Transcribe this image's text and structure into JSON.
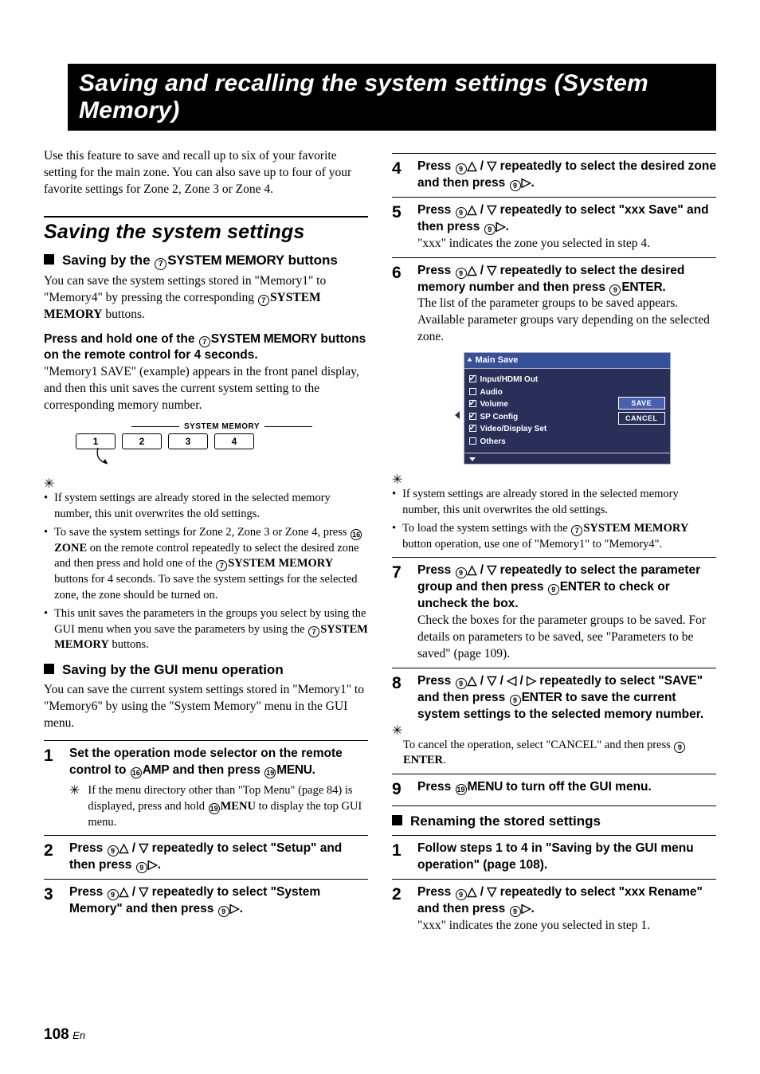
{
  "page": {
    "title": "Saving and recalling the system settings (System Memory)",
    "intro": "Use this feature to save and recall up to six of your favorite setting for the main zone. You can also save up to four of your favorite settings for Zone 2, Zone 3 or Zone 4.",
    "number": "108",
    "lang": "En"
  },
  "left": {
    "section_heading": "Saving the system settings",
    "sub1_prefix": "Saving by the ",
    "sub1_heavy": "SYSTEM MEMORY",
    "sub1_suffix": " buttons",
    "p1a": "You can save the system settings stored in \"Memory1\" to \"Memory4\" by pressing the corresponding ",
    "p1b": "SYSTEM MEMORY",
    "p1c": " buttons.",
    "press_lead_a": "Press and hold one of the ",
    "press_lead_b": "SYSTEM MEMORY",
    "press_lead_c": " buttons on the remote control for 4 seconds.",
    "press_body": "\"Memory1 SAVE\" (example) appears in the front panel display, and then this unit saves the current system setting to the corresponding memory number.",
    "sysmem_label": "SYSTEM MEMORY",
    "keys": [
      "1",
      "2",
      "3",
      "4"
    ],
    "tips1": {
      "b1": "If system settings are already stored in the selected memory number, this unit overwrites the old settings.",
      "b2a": "To save the system settings for Zone 2, Zone 3 or Zone 4, press ",
      "b2b": "ZONE",
      "b2c": " on the remote control repeatedly to select the desired zone and then press and hold one of the ",
      "b2d": "SYSTEM MEMORY",
      "b2e": " buttons for 4 seconds. To save the system settings for the selected zone, the zone should be turned on.",
      "b3a": "This unit saves the parameters in the groups you select by using the GUI menu when you save the parameters by using the ",
      "b3b": "SYSTEM MEMORY",
      "b3c": " buttons."
    },
    "sub2": "Saving by the GUI menu operation",
    "p2": "You can save the current system settings stored in \"Memory1\" to \"Memory6\" by using the \"System Memory\" menu in the GUI menu.",
    "step1": {
      "num": "1",
      "lead_a": "Set the operation mode selector on the remote control to ",
      "lead_b": "AMP",
      "lead_c": " and then press ",
      "lead_d": "MENU",
      "lead_e": ".",
      "tip_a": "If the menu directory other than \"Top Menu\" (page 84) is displayed, press and hold ",
      "tip_b": "MENU",
      "tip_c": " to display the top GUI menu."
    },
    "step2": {
      "num": "2",
      "lead_a": "Press ",
      "lead_b": " repeatedly to select \"Setup\" and then press ",
      "lead_c": "."
    },
    "step3": {
      "num": "3",
      "lead_a": "Press ",
      "lead_b": " repeatedly to select \"System Memory\" and then press ",
      "lead_c": "."
    }
  },
  "right": {
    "step4": {
      "num": "4",
      "lead_a": "Press ",
      "lead_b": " repeatedly to select the desired zone and then press ",
      "lead_c": "."
    },
    "step5": {
      "num": "5",
      "lead_a": "Press ",
      "lead_b": " repeatedly to select \"xxx Save\" and then press ",
      "lead_c": ".",
      "body": "\"xxx\" indicates the zone you selected in step 4."
    },
    "step6": {
      "num": "6",
      "lead_a": "Press ",
      "lead_b": " repeatedly to select the desired memory number and then press ",
      "lead_c": "ENTER",
      "lead_d": ".",
      "body": "The list of the parameter groups to be saved appears. Available parameter groups vary depending on the selected zone."
    },
    "gui": {
      "title": "Main Save",
      "items": [
        {
          "label": "Input/HDMI Out",
          "checked": true
        },
        {
          "label": "Audio",
          "checked": false
        },
        {
          "label": "Volume",
          "checked": true
        },
        {
          "label": "SP Config",
          "checked": true
        },
        {
          "label": "Video/Display Set",
          "checked": true
        },
        {
          "label": "Others",
          "checked": false
        }
      ],
      "btn_save": "SAVE",
      "btn_cancel": "CANCEL"
    },
    "tips2": {
      "b1": "If system settings are already stored in the selected memory number, this unit overwrites the old settings.",
      "b2a": "To load the system settings with the ",
      "b2b": "SYSTEM MEMORY",
      "b2c": " button operation, use one of \"Memory1\" to \"Memory4\"."
    },
    "step7": {
      "num": "7",
      "lead_a": "Press ",
      "lead_b": " repeatedly to select the parameter group and then press ",
      "lead_c": "ENTER",
      "lead_d": " to check or uncheck the box.",
      "body": "Check the boxes for the parameter groups to be saved. For details on parameters to be saved, see \"Parameters to be saved\" (page 109)."
    },
    "step8": {
      "num": "8",
      "lead_a": "Press ",
      "lead_b": " repeatedly to select \"SAVE\" and then press ",
      "lead_c": "ENTER",
      "lead_d": " to save the current system settings to the selected memory number.",
      "tip_a": "To cancel the operation, select \"CANCEL\" and then press ",
      "tip_b": "ENTER",
      "tip_c": "."
    },
    "step9": {
      "num": "9",
      "lead_a": "Press ",
      "lead_b": "MENU",
      "lead_c": " to turn off the GUI menu."
    },
    "sub3": "Renaming the stored settings",
    "r_step1": {
      "num": "1",
      "lead": "Follow steps 1 to 4 in \"Saving by the GUI menu operation\" (page 108)."
    },
    "r_step2": {
      "num": "2",
      "lead_a": "Press ",
      "lead_b": " repeatedly to select \"xxx Rename\" and then press ",
      "lead_c": ".",
      "body": "\"xxx\" indicates the zone you selected in step 1."
    }
  }
}
